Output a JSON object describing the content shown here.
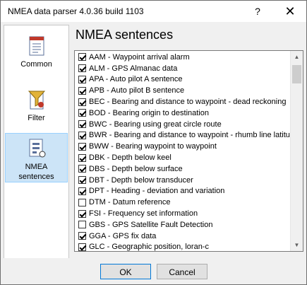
{
  "window": {
    "title": "NMEA data parser 4.0.36 build 1103",
    "help_label": "?",
    "close_label": "✕"
  },
  "sidebar": {
    "items": [
      {
        "label": "Common",
        "icon": "document-icon",
        "active": false
      },
      {
        "label": "Filter",
        "icon": "filter-icon",
        "active": false
      },
      {
        "label": "NMEA sentences",
        "icon": "nmea-sentences-icon",
        "active": true
      }
    ]
  },
  "main": {
    "heading": "NMEA sentences",
    "sentences": [
      {
        "label": "AAM - Waypoint arrival alarm",
        "checked": true
      },
      {
        "label": "ALM - GPS Almanac data",
        "checked": true
      },
      {
        "label": "APA - Auto pilot A sentence",
        "checked": true
      },
      {
        "label": "APB - Auto pilot B sentence",
        "checked": true
      },
      {
        "label": "BEC - Bearing and distance to waypoint - dead reckoning",
        "checked": true
      },
      {
        "label": "BOD - Bearing origin to destination",
        "checked": true
      },
      {
        "label": "BWC - Bearing using great circle route",
        "checked": true
      },
      {
        "label": "BWR - Bearing and distance to waypoint - rhumb line latitude",
        "checked": true
      },
      {
        "label": "BWW - Bearing waypoint to waypoint",
        "checked": true
      },
      {
        "label": "DBK - Depth below keel",
        "checked": true
      },
      {
        "label": "DBS - Depth below surface",
        "checked": true
      },
      {
        "label": "DBT - Depth below transducer",
        "checked": true
      },
      {
        "label": "DPT - Heading - deviation and variation",
        "checked": true
      },
      {
        "label": "DTM - Datum reference",
        "checked": false
      },
      {
        "label": "FSI - Frequency set information",
        "checked": true
      },
      {
        "label": "GBS - GPS Satellite Fault Detection",
        "checked": false
      },
      {
        "label": "GGA - GPS fix data",
        "checked": true
      },
      {
        "label": "GLC - Geographic position, loran-c",
        "checked": true
      }
    ]
  },
  "buttons": {
    "ok": "OK",
    "cancel": "Cancel"
  }
}
